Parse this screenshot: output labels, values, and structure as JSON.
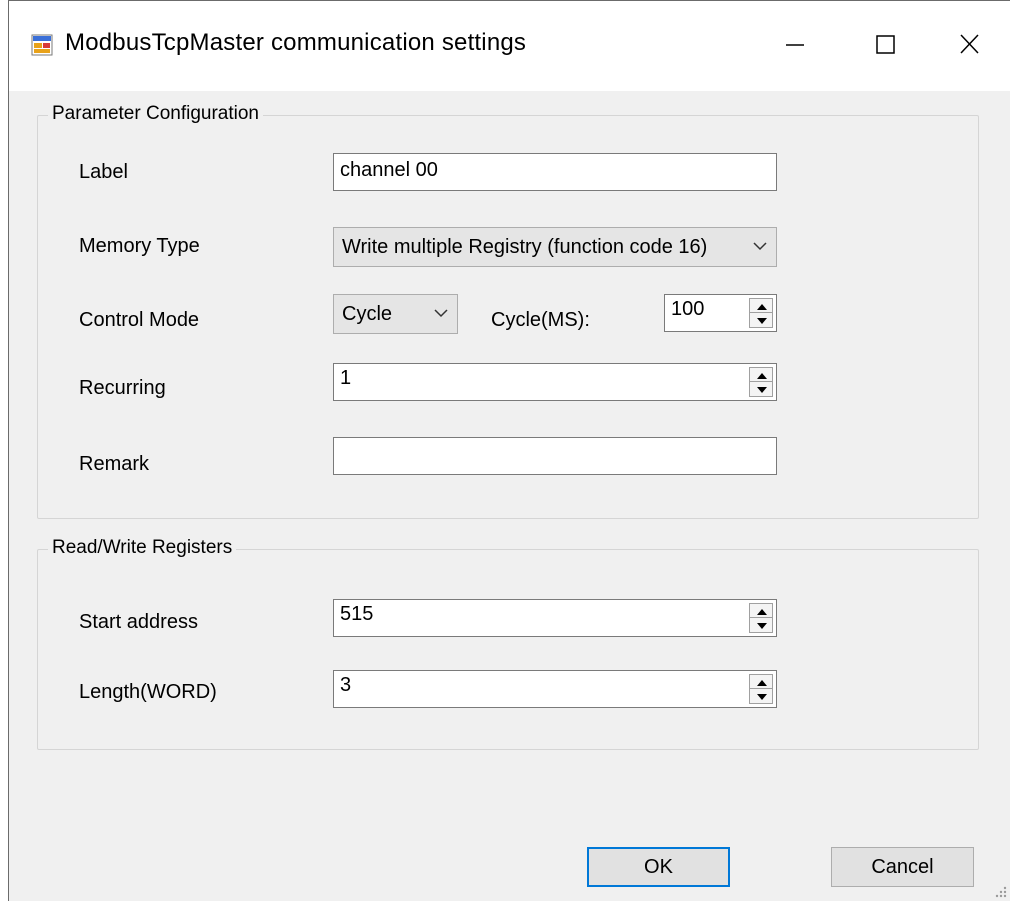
{
  "window": {
    "title": "ModbusTcpMaster communication settings",
    "app_icon": "form-app-icon",
    "controls": {
      "minimize": "minimize-icon",
      "maximize": "maximize-icon",
      "close": "close-icon"
    }
  },
  "parameter_group": {
    "title": "Parameter Configuration",
    "label_caption": "Label",
    "label_value": "channel 00",
    "memory_type_caption": "Memory Type",
    "memory_type_value": "Write multiple Registry (function code 16)",
    "control_mode_caption": "Control Mode",
    "control_mode_value": "Cycle",
    "cycle_caption": "Cycle(MS):",
    "cycle_value": "100",
    "recurring_caption": "Recurring",
    "recurring_value": "1",
    "remark_caption": "Remark",
    "remark_value": ""
  },
  "registers_group": {
    "title": "Read/Write Registers",
    "start_address_caption": "Start address",
    "start_address_value": "515",
    "length_caption": "Length(WORD)",
    "length_value": "3"
  },
  "buttons": {
    "ok": "OK",
    "cancel": "Cancel"
  },
  "colors": {
    "accent": "#0078d7",
    "dialog_bg": "#f0f0f0"
  }
}
